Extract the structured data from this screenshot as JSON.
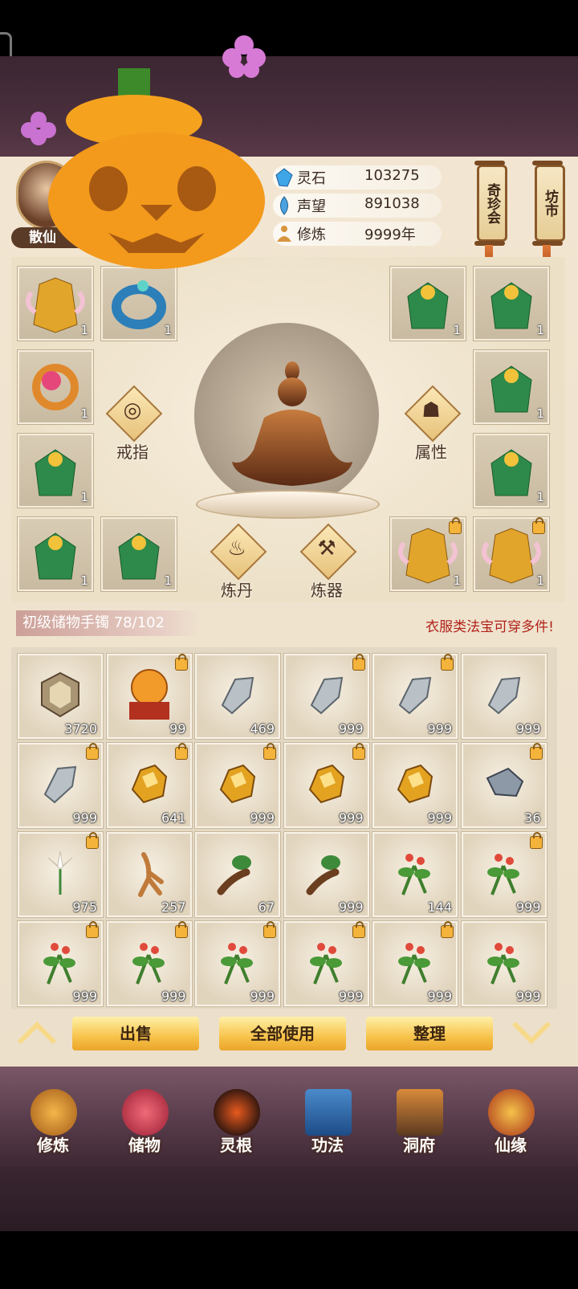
{
  "player": {
    "name": "散仙"
  },
  "resources": [
    {
      "icon": "spirit-stone-icon",
      "label": "灵石",
      "value": "103275"
    },
    {
      "icon": "prestige-icon",
      "label": "声望",
      "value": "891038"
    },
    {
      "icon": "cultivation-icon",
      "label": "修炼",
      "value": "9999年"
    }
  ],
  "side_buttons": {
    "treasure_fair": "奇珍会",
    "market": "坊市"
  },
  "equipment": {
    "ring_label": "戒指",
    "attributes_label": "属性",
    "alchemy_label": "炼丹",
    "forge_label": "炼器",
    "slot_count": "1"
  },
  "bag": {
    "title": "初级储物手镯 78/102",
    "tip": "衣服类法宝可穿多件!",
    "items": [
      {
        "icon": "spirit-crystal-icon",
        "count": "3720",
        "locked": false
      },
      {
        "icon": "orb-on-stand-icon",
        "count": "99",
        "locked": true
      },
      {
        "icon": "iron-ore-icon",
        "count": "469",
        "locked": false
      },
      {
        "icon": "iron-ore-icon",
        "count": "999",
        "locked": true
      },
      {
        "icon": "iron-ore-icon",
        "count": "999",
        "locked": true
      },
      {
        "icon": "iron-ore-icon",
        "count": "999",
        "locked": false
      },
      {
        "icon": "iron-ore-icon",
        "count": "999",
        "locked": true
      },
      {
        "icon": "gold-ore-icon",
        "count": "641",
        "locked": true
      },
      {
        "icon": "gold-ore-icon",
        "count": "999",
        "locked": true
      },
      {
        "icon": "gold-ore-icon",
        "count": "999",
        "locked": true
      },
      {
        "icon": "gold-ore-icon",
        "count": "999",
        "locked": false
      },
      {
        "icon": "dark-ore-icon",
        "count": "36",
        "locked": true
      },
      {
        "icon": "white-lily-icon",
        "count": "975",
        "locked": true
      },
      {
        "icon": "ginseng-icon",
        "count": "257",
        "locked": false
      },
      {
        "icon": "herb-root-icon",
        "count": "67",
        "locked": false
      },
      {
        "icon": "herb-root-icon",
        "count": "999",
        "locked": false
      },
      {
        "icon": "red-flower-herb-icon",
        "count": "144",
        "locked": false
      },
      {
        "icon": "red-flower-herb-icon",
        "count": "999",
        "locked": true
      },
      {
        "icon": "red-flower-herb-icon",
        "count": "999",
        "locked": true
      },
      {
        "icon": "red-flower-herb-icon",
        "count": "999",
        "locked": true
      },
      {
        "icon": "red-flower-herb-icon",
        "count": "999",
        "locked": true
      },
      {
        "icon": "red-flower-herb-icon",
        "count": "999",
        "locked": true
      },
      {
        "icon": "red-flower-herb-icon",
        "count": "999",
        "locked": true
      },
      {
        "icon": "red-flower-herb-icon",
        "count": "999",
        "locked": false
      }
    ]
  },
  "actions": {
    "sell": "出售",
    "use_all": "全部使用",
    "sort": "整理"
  },
  "nav": [
    {
      "icon": "cultivate-nav-icon",
      "label": "修炼"
    },
    {
      "icon": "storage-nav-icon",
      "label": "储物"
    },
    {
      "icon": "spirit-root-nav-icon",
      "label": "灵根"
    },
    {
      "icon": "technique-nav-icon",
      "label": "功法"
    },
    {
      "icon": "cave-dwelling-nav-icon",
      "label": "洞府"
    },
    {
      "icon": "fate-nav-icon",
      "label": "仙缘"
    }
  ],
  "colors": {
    "accent": "#f7c34a",
    "tip_red": "#b2221a",
    "frame": "#f2e6d2",
    "nav_bg": "#5b3e4d"
  }
}
